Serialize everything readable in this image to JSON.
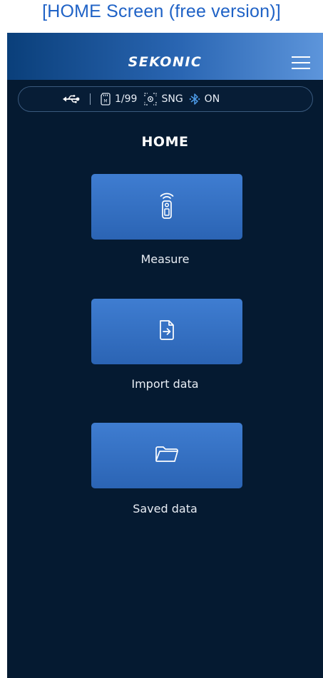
{
  "caption": "[HOME Screen (free version)]",
  "header": {
    "brand": "SEKONIC",
    "menu_icon": "hamburger-menu-icon"
  },
  "status_bar": {
    "usb_icon": "usb-icon",
    "memory_icon": "memory-card-icon",
    "memory_count": "1/99",
    "mode_icon": "measure-mode-icon",
    "mode": "SNG",
    "bluetooth_icon": "bluetooth-icon",
    "bluetooth_state": "ON"
  },
  "page_title": "HOME",
  "tiles": [
    {
      "label": "Measure",
      "icon": "light-meter-icon"
    },
    {
      "label": "Import data",
      "icon": "file-import-icon"
    },
    {
      "label": "Saved data",
      "icon": "folder-icon"
    }
  ],
  "colors": {
    "caption": "#1f62c6",
    "background": "#051a31",
    "header_gradient_start": "#0a3f7a",
    "header_gradient_end": "#5d95db",
    "tile": "#3671c4",
    "bluetooth_accent": "#4d9be8"
  }
}
